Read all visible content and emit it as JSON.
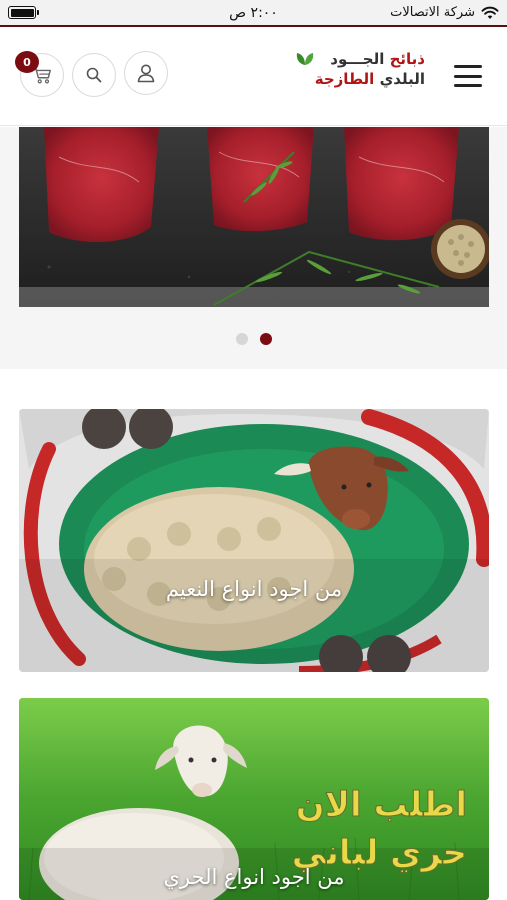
{
  "status_bar": {
    "carrier": "شركة الاتصالات",
    "time": "٢:٠٠ ص"
  },
  "header": {
    "cart_count": "0",
    "logo": {
      "line1_red": "ذبائح",
      "line1_dark": "الجـــود",
      "line2_dark": "البلدي",
      "line2_red": "الطازجة"
    },
    "icons": [
      "cart-icon",
      "search-icon",
      "user-icon",
      "menu-icon"
    ]
  },
  "slider": {
    "slide_count": 2,
    "active_index": 1
  },
  "cards": [
    {
      "caption": "من اجود انواع النعيم"
    },
    {
      "caption": "من اجود انواع الحري",
      "headline_1": "اطلب الان",
      "headline_2": "حري لباني"
    }
  ],
  "colors": {
    "brand_dark_red": "#7a0c12",
    "logo_red": "#b01616",
    "logo_green": "#3a8a2a"
  }
}
